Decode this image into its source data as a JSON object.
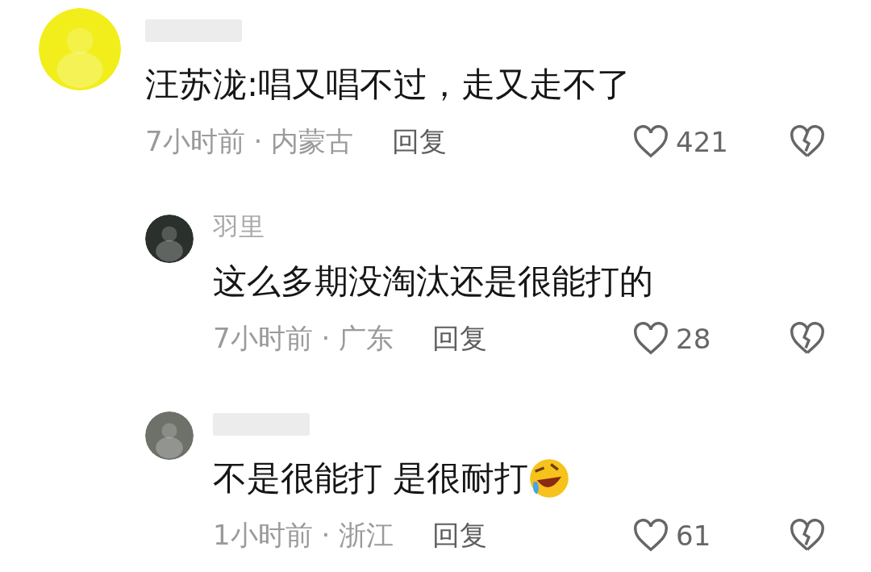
{
  "comments": [
    {
      "name_hidden": true,
      "text": "汪苏泷:唱又唱不过，走又走不了",
      "time": "7小时前",
      "separator": "·",
      "location": "内蒙古",
      "reply_label": "回复",
      "likes": "421",
      "emoji": false,
      "replies": [
        {
          "name": "羽里",
          "name_hidden": false,
          "text": "这么多期没淘汰还是很能打的",
          "time": "7小时前",
          "separator": "·",
          "location": "广东",
          "reply_label": "回复",
          "likes": "28",
          "emoji": false
        },
        {
          "name_hidden": true,
          "text": "不是很能打 是很耐打",
          "time": "1小时前",
          "separator": "·",
          "location": "浙江",
          "reply_label": "回复",
          "likes": "61",
          "emoji": true
        }
      ]
    }
  ]
}
